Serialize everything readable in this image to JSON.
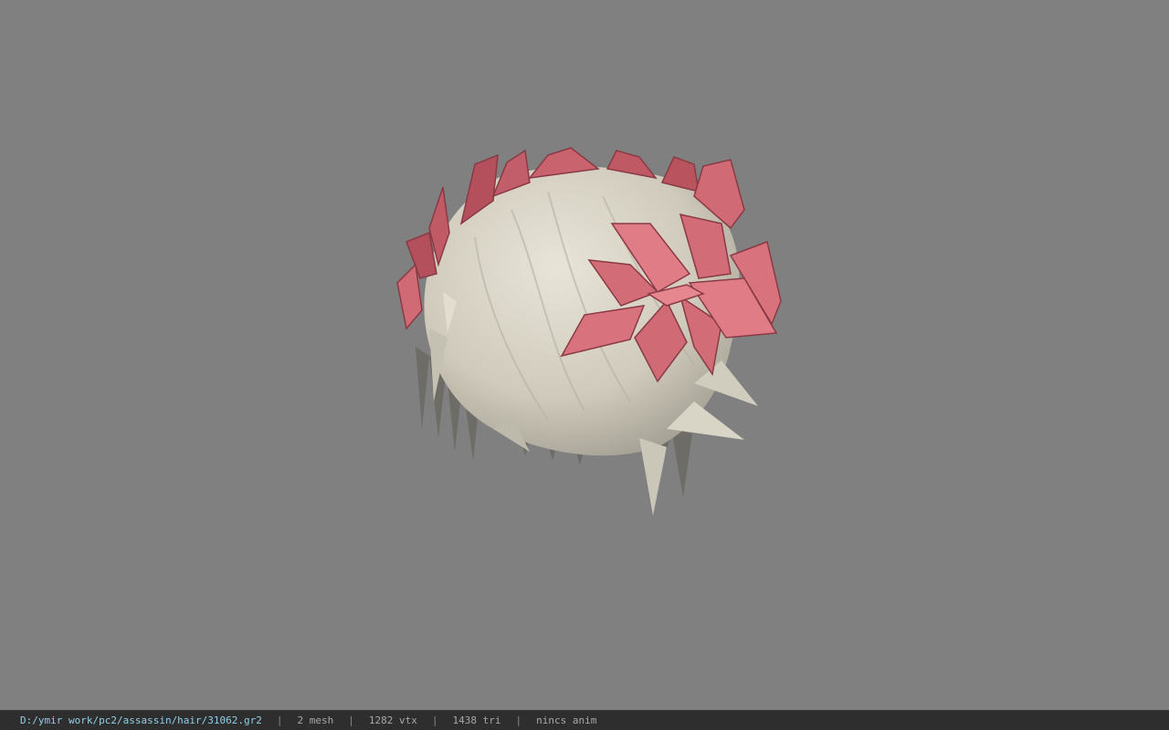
{
  "viewport": {
    "background_color": "#808080",
    "model": {
      "hair_color": "#d6d2c4",
      "flower_color": "#d9707a",
      "flower_shade_color": "#a84a55"
    }
  },
  "status_bar": {
    "file_path": "D:/ymir work/pc2/assassin/hair/31062.gr2",
    "separator": "|",
    "mesh_count": "2 mesh",
    "vertex_count": "1282 vtx",
    "triangle_count": "1438 tri",
    "anim_state": "nincs anim"
  }
}
